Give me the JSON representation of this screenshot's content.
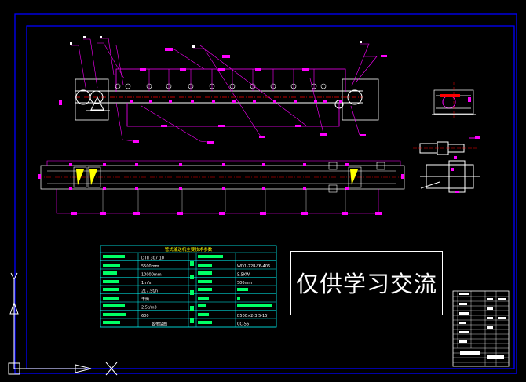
{
  "app": {
    "type": "CAD drawing viewer"
  },
  "watermark": {
    "text": "仅供学习交流"
  },
  "spec_table": {
    "title": "管式输送机主要技术参数",
    "left_values": [
      "DTII 307 10",
      "5500mm",
      "10000mm",
      "1m/s",
      "217.5t/h",
      "干燥",
      "2.5t/m3",
      "600",
      "胶带绕曲"
    ],
    "right_values": [
      "",
      "WD1-22R-Y6-406",
      "5.5KW",
      "500mm",
      "",
      "",
      "",
      "B500×2(3.5-15)",
      "CC-56"
    ]
  },
  "colors": {
    "background": "#000000",
    "frame": "#0000ff",
    "magenta": "#ff00ff",
    "white": "#ffffff",
    "cyan": "#00ffff",
    "yellow": "#ffff00",
    "red": "#ff0000"
  },
  "ucs": {
    "y_label": "Y",
    "x_label": "X"
  }
}
